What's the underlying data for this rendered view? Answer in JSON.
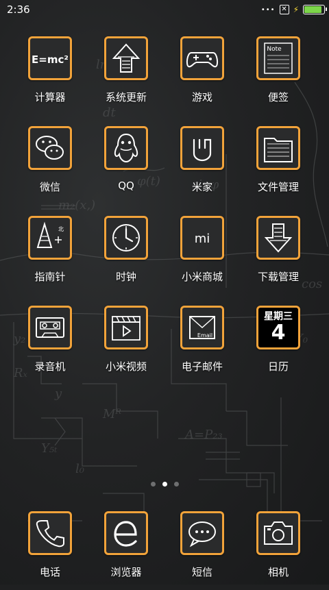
{
  "status": {
    "time": "2:36",
    "icons": [
      "more-dots-icon",
      "no-sim-icon",
      "charging-bolt-icon",
      "battery-icon"
    ],
    "battery_level_fraction": 0.95
  },
  "apps": [
    {
      "label": "计算器",
      "icon": "calculator-emc2-icon",
      "icon_text": "E=mc²"
    },
    {
      "label": "系统更新",
      "icon": "system-update-arrow-icon"
    },
    {
      "label": "游戏",
      "icon": "gamepad-icon"
    },
    {
      "label": "便签",
      "icon": "notes-icon",
      "icon_text": "Note"
    },
    {
      "label": "微信",
      "icon": "wechat-icon"
    },
    {
      "label": "QQ",
      "icon": "qq-penguin-icon"
    },
    {
      "label": "米家",
      "icon": "mijia-icon"
    },
    {
      "label": "文件管理",
      "icon": "file-folder-icon"
    },
    {
      "label": "指南针",
      "icon": "compass-icon"
    },
    {
      "label": "时钟",
      "icon": "clock-icon"
    },
    {
      "label": "小米商城",
      "icon": "mi-store-icon",
      "icon_text": "mi"
    },
    {
      "label": "下载管理",
      "icon": "download-arrow-icon"
    },
    {
      "label": "录音机",
      "icon": "cassette-recorder-icon"
    },
    {
      "label": "小米视频",
      "icon": "video-clapper-icon"
    },
    {
      "label": "电子邮件",
      "icon": "email-icon",
      "icon_text": "Email"
    },
    {
      "label": "日历",
      "icon": "calendar-icon",
      "week": "星期三",
      "day": "4"
    }
  ],
  "pages": {
    "count": 3,
    "active_index": 1
  },
  "dock": [
    {
      "label": "电话",
      "icon": "phone-icon"
    },
    {
      "label": "浏览器",
      "icon": "browser-e-icon"
    },
    {
      "label": "短信",
      "icon": "sms-bubble-icon"
    },
    {
      "label": "相机",
      "icon": "camera-icon"
    }
  ],
  "colors": {
    "tile_border": "#f2a33a",
    "background": "#1f2021",
    "battery": "#7cd64a"
  }
}
